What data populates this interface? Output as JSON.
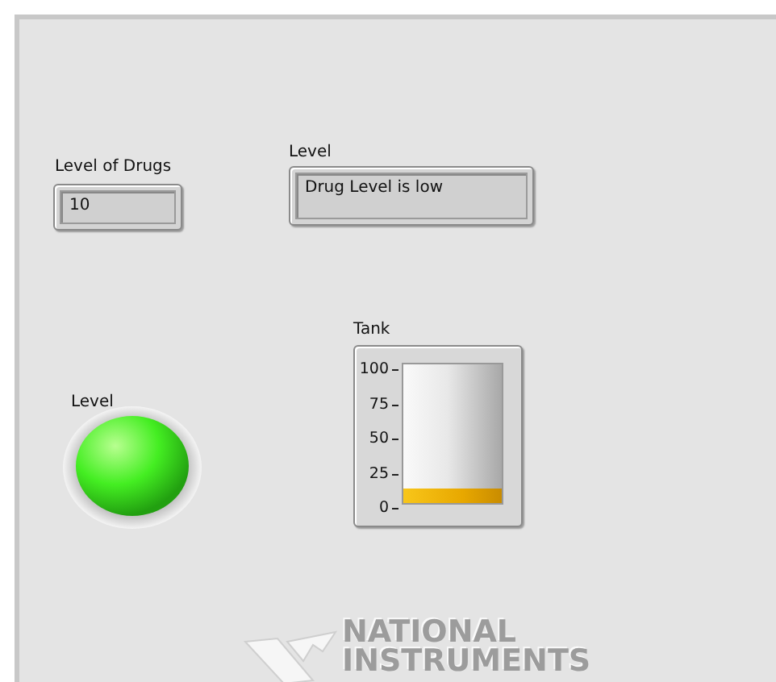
{
  "numeric_indicator": {
    "label": "Level of Drugs",
    "value": "10"
  },
  "string_indicator": {
    "label": "Level",
    "value": "Drug Level is low"
  },
  "led": {
    "label": "Level",
    "on": true
  },
  "tank": {
    "label": "Tank",
    "scale": [
      "100",
      "75",
      "50",
      "25",
      "0"
    ],
    "level": 0.1
  },
  "logo": {
    "lines": [
      "NATIONAL",
      "INSTRUMENTS"
    ]
  }
}
